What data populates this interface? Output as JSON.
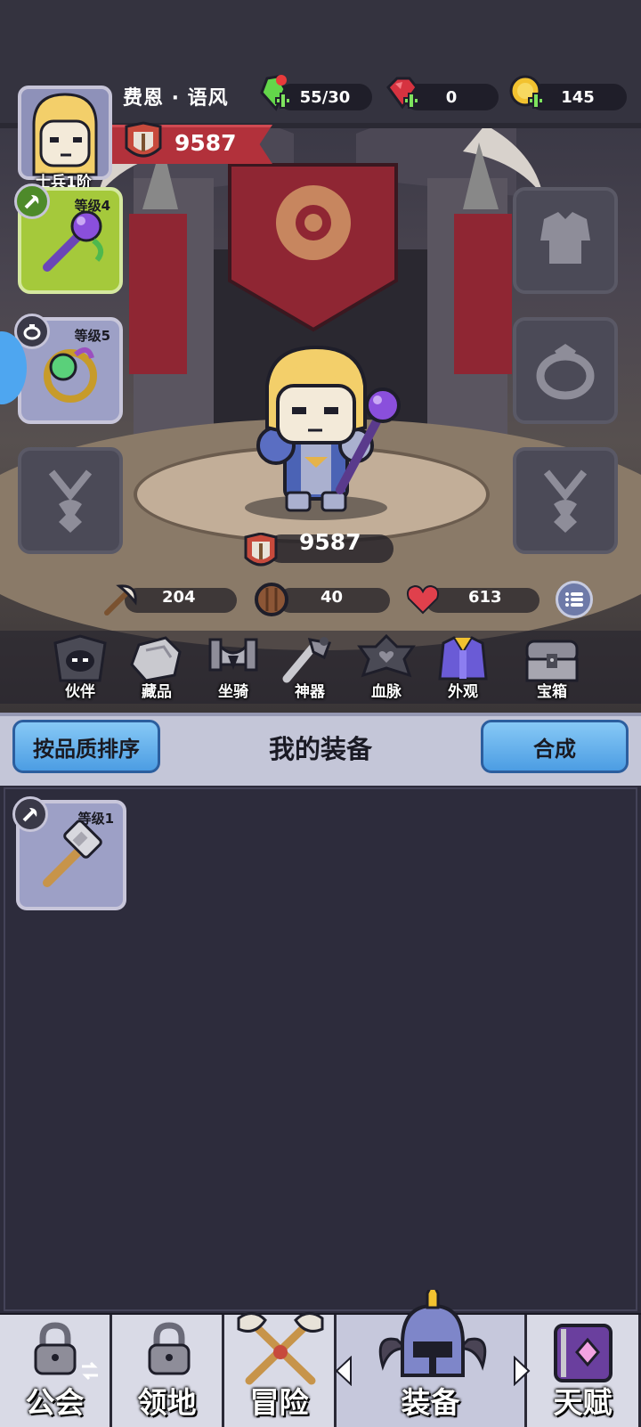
{
  "player": {
    "name": "费恩 · 语风",
    "rank": "士兵1阶",
    "power": "9587"
  },
  "resources": [
    {
      "name": "energy",
      "value": "55/30",
      "color": "#63d64a",
      "icon": "green-crystal-icon"
    },
    {
      "name": "ruby",
      "value": "0",
      "color": "#d63340",
      "icon": "red-gem-icon"
    },
    {
      "name": "gold",
      "value": "145",
      "color": "#f2c230",
      "icon": "gold-coin-icon"
    }
  ],
  "equipment_slots": {
    "weapon": {
      "level": "等级4",
      "icon": "purple-orb-staff-icon"
    },
    "ring": {
      "level": "等级5",
      "icon": "green-orb-ring-icon"
    },
    "armor": {
      "icon": "armor-placeholder-icon"
    },
    "ring2": {
      "icon": "ring-placeholder-icon"
    },
    "necklace_left": {
      "icon": "necklace-placeholder-icon"
    },
    "necklace_right": {
      "icon": "necklace-placeholder-icon"
    }
  },
  "hero": {
    "total_power": "9587"
  },
  "stats": [
    {
      "name": "attack",
      "value": "204",
      "icon": "axe-icon"
    },
    {
      "name": "defense",
      "value": "40",
      "icon": "shield-icon"
    },
    {
      "name": "health",
      "value": "613",
      "icon": "heart-icon"
    }
  ],
  "features": [
    {
      "label": "伙伴",
      "icon": "hooded-partner-icon"
    },
    {
      "label": "藏品",
      "icon": "collection-stone-icon"
    },
    {
      "label": "坐骑",
      "icon": "mount-icon"
    },
    {
      "label": "神器",
      "icon": "artifact-icon"
    },
    {
      "label": "血脉",
      "icon": "bloodline-icon"
    },
    {
      "label": "外观",
      "icon": "outfit-icon"
    },
    {
      "label": "宝箱",
      "icon": "treasure-chest-icon"
    }
  ],
  "equip_panel": {
    "sort_label": "按品质排序",
    "title": "我的装备",
    "craft_label": "合成",
    "items": [
      {
        "level": "等级1",
        "icon": "hammer-icon"
      }
    ]
  },
  "nav": {
    "tabs": [
      {
        "label": "公会",
        "locked": true
      },
      {
        "label": "领地",
        "locked": true
      },
      {
        "label": "冒险",
        "locked": false
      },
      {
        "label": "装备",
        "locked": false,
        "active": true
      },
      {
        "label": "天赋",
        "locked": false
      }
    ]
  }
}
